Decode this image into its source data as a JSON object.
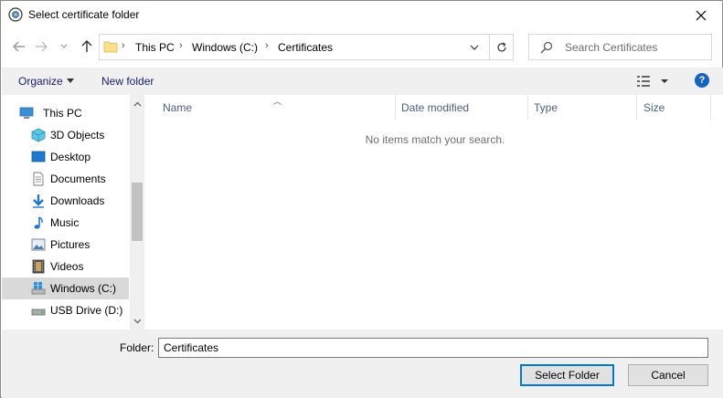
{
  "window": {
    "title": "Select certificate folder"
  },
  "address": {
    "crumbs": [
      "This PC",
      "Windows (C:)",
      "Certificates"
    ]
  },
  "search": {
    "placeholder": "Search Certificates"
  },
  "toolbar": {
    "organize": "Organize",
    "new_folder": "New folder",
    "help": "?"
  },
  "nav": {
    "items": [
      {
        "label": "This PC",
        "icon": "computer-icon"
      },
      {
        "label": "3D Objects",
        "icon": "cube-icon"
      },
      {
        "label": "Desktop",
        "icon": "desktop-icon"
      },
      {
        "label": "Documents",
        "icon": "document-icon"
      },
      {
        "label": "Downloads",
        "icon": "download-icon"
      },
      {
        "label": "Music",
        "icon": "music-note-icon"
      },
      {
        "label": "Pictures",
        "icon": "picture-icon"
      },
      {
        "label": "Videos",
        "icon": "film-icon"
      },
      {
        "label": "Windows (C:)",
        "icon": "windows-drive-icon",
        "selected": true
      },
      {
        "label": "USB Drive (D:)",
        "icon": "usb-drive-icon"
      }
    ]
  },
  "columns": [
    "Name",
    "Date modified",
    "Type",
    "Size"
  ],
  "content": {
    "empty_message": "No items match your search."
  },
  "footer": {
    "folder_label": "Folder:",
    "folder_value": "Certificates",
    "select_button": "Select Folder",
    "cancel_button": "Cancel"
  },
  "colors": {
    "accent": "#0078d7",
    "selected_bg": "#d9d9d9",
    "help": "#1565c0"
  }
}
